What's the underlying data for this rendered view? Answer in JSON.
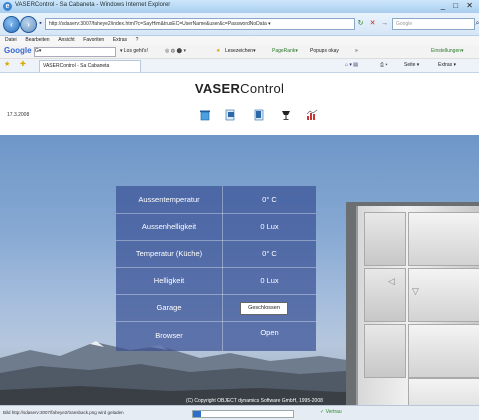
{
  "window": {
    "title": "VASERControl - Sa Cabaneta - Windows Internet Explorer",
    "controls": "_ □ ✕"
  },
  "addressbar": {
    "url": "http://sdaserv:3007/faheye2/index.html?c=SayHim&trusEC=UserName&user&c=PasswordNoData ▾",
    "search_placeholder": "Google"
  },
  "menu": {
    "items": [
      "Datei",
      "Bearbeiten",
      "Ansicht",
      "Favoriten",
      "Extras",
      "?"
    ]
  },
  "google_toolbar": {
    "label": "Google",
    "search_box": "G▾",
    "go": "▾ Los geht's!",
    "bookmarks": "Lesezeichen▾",
    "pagerank": "PageRank▾",
    "popups": "Popups okay",
    "more": "»",
    "settings": "Einstellungen▾"
  },
  "favorites_bar": {
    "tab_title": "VASERControl - Sa Cabaneta",
    "page_menu": "Seite ▾",
    "extras_menu": "Extras ▾"
  },
  "page": {
    "app_title_bold": "VASER",
    "app_title_rest": "Control",
    "date": "17.3.2008",
    "copyright": "(C) Copyright OBJECT dynamics Software GmbH, 1995-2008"
  },
  "panel": {
    "rows": [
      {
        "label": "Aussentemperatur",
        "value": "0° C"
      },
      {
        "label": "Aussenhelligkeit",
        "value": "0 Lux"
      },
      {
        "label": "Temperatur (Küche)",
        "value": "0° C"
      },
      {
        "label": "Helligkeit",
        "value": "0 Lux"
      },
      {
        "label": "Garage",
        "button": "Geschlossen"
      },
      {
        "label": "Browser",
        "value": "Open"
      }
    ]
  },
  "statusbar": {
    "text": "Bild http://sdaserv:3007/faheye2/transback.png wird geladen",
    "progress": 0.08,
    "zone": "✓ Vertrau"
  },
  "colors": {
    "panel": "#3a5296",
    "sky_top": "#6e97c8",
    "titlebar": "#a9cdee"
  }
}
